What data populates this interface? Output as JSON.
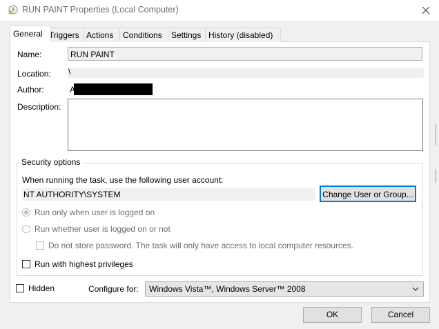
{
  "window": {
    "title": "RUN PAINT Properties (Local Computer)",
    "close_symbol": "✕"
  },
  "tabs": [
    {
      "label": "General",
      "selected": true
    },
    {
      "label": "Triggers"
    },
    {
      "label": "Actions"
    },
    {
      "label": "Conditions"
    },
    {
      "label": "Settings"
    },
    {
      "label": "History (disabled)"
    }
  ],
  "general": {
    "name_label": "Name:",
    "name_value": "RUN PAINT",
    "location_label": "Location:",
    "location_value": "\\",
    "author_label": "Author:",
    "author_visible": "A",
    "description_label": "Description:",
    "description_value": ""
  },
  "security": {
    "legend": "Security options",
    "account_prompt": "When running the task, use the following user account:",
    "account_value": "NT AUTHORITY\\SYSTEM",
    "change_button": "Change User or Group...",
    "radio_logged_on": "Run only when user is logged on",
    "radio_whether": "Run whether user is logged on or not",
    "no_store_password": "Do not store password.  The task will only have access to local computer resources.",
    "highest_privileges": "Run with highest privileges"
  },
  "footer": {
    "hidden_label": "Hidden",
    "configure_label": "Configure for:",
    "configure_value": "Windows Vista™, Windows Server™ 2008",
    "ok": "OK",
    "cancel": "Cancel"
  }
}
